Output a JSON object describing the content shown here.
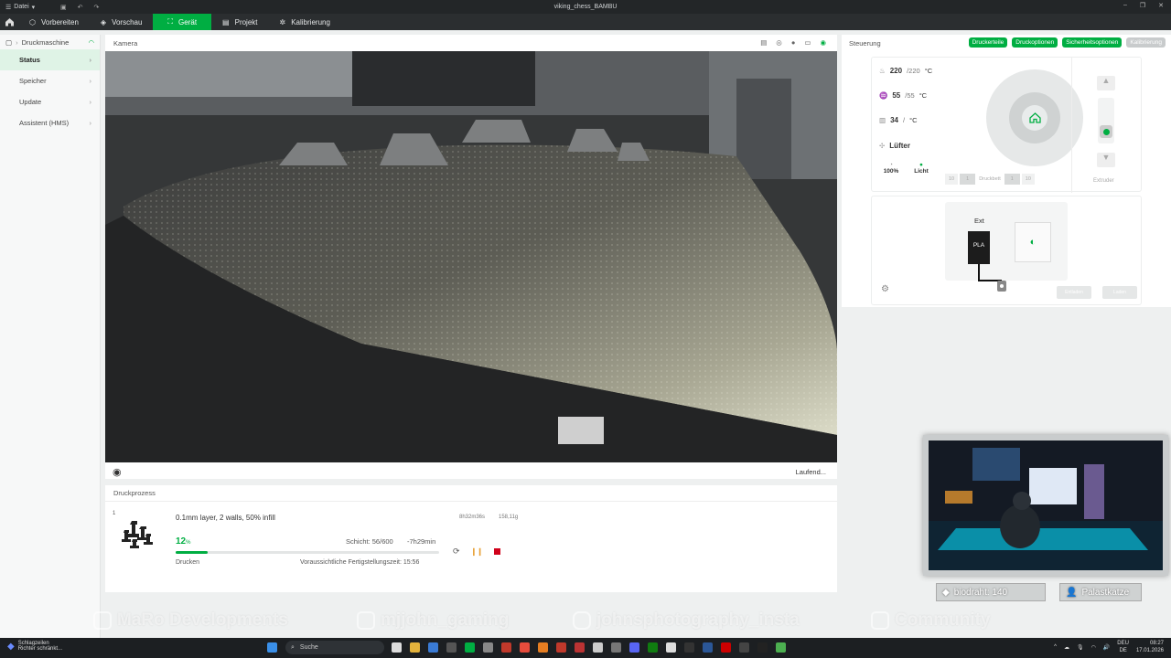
{
  "titlebar": {
    "menu_label": "Datei",
    "title": "viking_chess_BAMBU"
  },
  "nav": {
    "tabs": [
      {
        "label": "Vorbereiten",
        "icon": "cube-icon"
      },
      {
        "label": "Vorschau",
        "icon": "layers-icon"
      },
      {
        "label": "Gerät",
        "icon": "device-icon"
      },
      {
        "label": "Projekt",
        "icon": "project-icon"
      },
      {
        "label": "Kalibrierung",
        "icon": "calibration-icon"
      }
    ],
    "active": "Gerät"
  },
  "sidebar": {
    "header": "Druckmaschine",
    "items": [
      {
        "label": "Status"
      },
      {
        "label": "Speicher"
      },
      {
        "label": "Update"
      },
      {
        "label": "Assistent (HMS)"
      }
    ]
  },
  "camera": {
    "title": "Kamera",
    "status": "Laufend..."
  },
  "job": {
    "section_title": "Druckprozess",
    "index": "1",
    "name": "0.1mm layer, 2 walls, 50% infill",
    "total_time": "8h32m36s",
    "weight": "158,11g",
    "progress": 12,
    "progress_label": "12",
    "progress_unit": "%",
    "layer": "Schicht: 56/600",
    "remaining": "-7h29min",
    "status": "Drucken",
    "eta": "Voraussichtliche Fertigstellungszeit: 15:56"
  },
  "control": {
    "title": "Steuerung",
    "buttons": [
      "Druckerteile",
      "Druckoptionen",
      "Sicherheitsoptionen",
      "Kalibrierung"
    ],
    "nozzle": {
      "current": "220",
      "target": "/220",
      "unit": "°C"
    },
    "bed": {
      "current": "55",
      "target": "/55",
      "unit": "°C"
    },
    "chamber": {
      "current": "34",
      "target": "/",
      "unit": "°C"
    },
    "fan_label": "Lüfter",
    "speed_value": "100%",
    "light_label": "Licht",
    "bed_row": [
      "10",
      "1",
      "Druckbett",
      "1",
      "10"
    ],
    "extruder_label": "Extruder",
    "ams_label": "Ext",
    "filament": "PLA",
    "unload": "Entladen",
    "load": "Laden"
  },
  "overlay": {
    "badge1": "biodraht: 140",
    "badge2": "Palastkatze",
    "socials": [
      "MaRo Developments",
      "mjjohn_gaming",
      "johnsphotography_insta",
      "Community"
    ]
  },
  "taskbar": {
    "news_title": "Schlagzeilen",
    "news_sub": "Richter schränkt...",
    "search": "Suche",
    "lang1": "DEU",
    "lang2": "DE",
    "time": "08:27",
    "date": "17.01.2026"
  },
  "colors": {
    "accent": "#00ae42",
    "titlebar": "#232628",
    "navbar": "#2b2e30"
  }
}
